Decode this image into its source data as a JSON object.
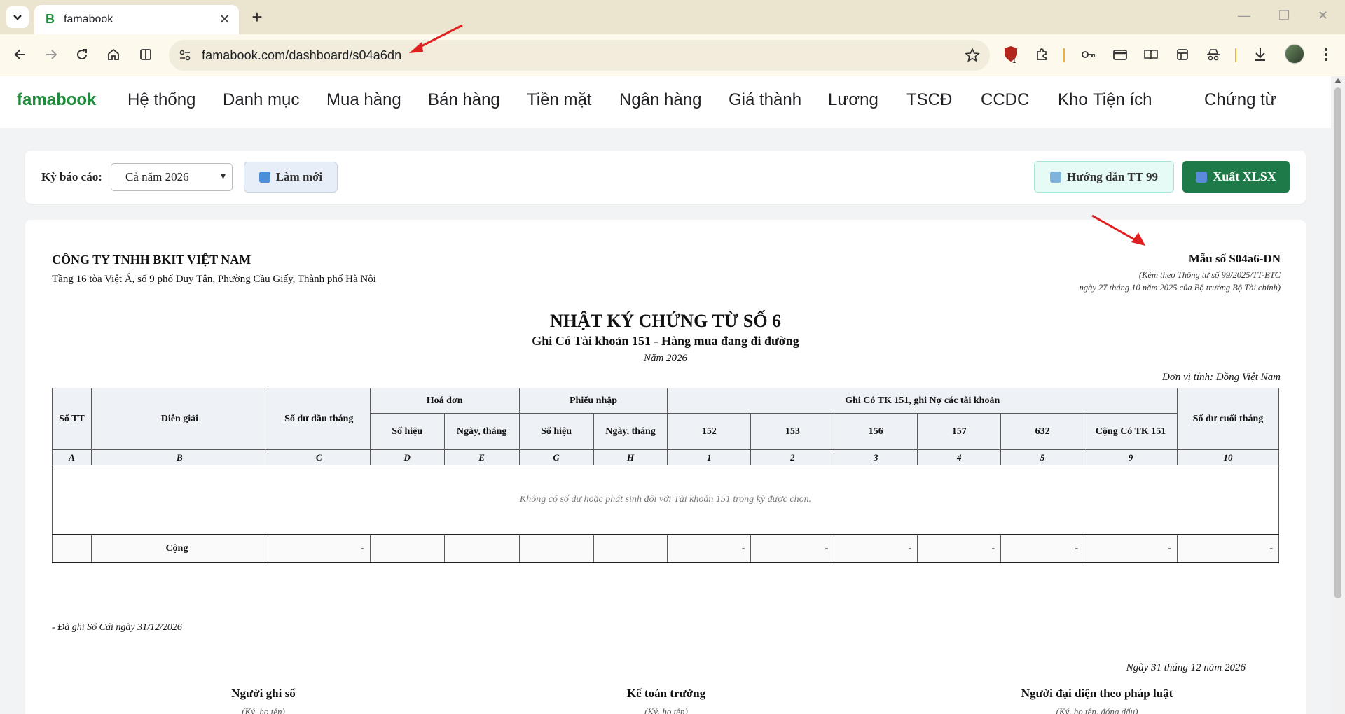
{
  "browser": {
    "tab_title": "famabook",
    "tab_favicon": "B",
    "url": "famabook.com/dashboard/s04a6dn",
    "extension_badge": "1",
    "icons": [
      "back-icon",
      "forward-icon",
      "reload-icon",
      "home-icon",
      "split-view-icon",
      "site-info-icon",
      "star-icon",
      "extension-icon",
      "puzzle-icon",
      "key-icon",
      "card-icon",
      "reading-list-icon",
      "tab-search-icon",
      "incognito-icon",
      "download-icon",
      "avatar"
    ]
  },
  "app": {
    "brand": "famabook",
    "nav": [
      "Hệ thống",
      "Danh mục",
      "Mua hàng",
      "Bán hàng",
      "Tiền mặt",
      "Ngân hàng",
      "Giá thành",
      "Lương",
      "TSCĐ",
      "CCDC",
      "Kho",
      "Tiện ích",
      "Chứng từ"
    ],
    "filter": {
      "label": "Kỳ báo cáo:",
      "period": "Cả năm 2026",
      "refresh": "Làm mới",
      "guide": "Hướng dẫn TT 99",
      "export": "Xuất XLSX"
    }
  },
  "report": {
    "company": "CÔNG TY TNHH BKIT VIỆT NAM",
    "address": "Tầng 16 tòa Việt Á, số 9 phố Duy Tân, Phường Cầu Giấy, Thành phố Hà Nội",
    "form_code": "Mẫu số S04a6-DN",
    "form_note1": "(Kèm theo Thông tư số 99/2025/TT-BTC",
    "form_note2": "ngày 27 tháng 10 năm 2025 của Bộ trưởng Bộ Tài chính)",
    "title": "NHẬT KÝ CHỨNG TỪ SỐ 6",
    "subtitle": "Ghi Có Tài khoản 151 - Hàng mua đang đi đường",
    "year": "Năm 2026",
    "unit": "Đơn vị tính: Đồng Việt Nam",
    "table": {
      "h_stt": "Số TT",
      "h_desc": "Diễn giải",
      "h_open": "Số dư đầu tháng",
      "h_invoice": "Hoá đơn",
      "h_receipt": "Phiếu nhập",
      "h_credit": "Ghi Có TK 151, ghi Nợ các tài khoản",
      "h_close": "Số dư cuối tháng",
      "h_so_hieu": "Số hiệu",
      "h_ngay": "Ngày, tháng",
      "accounts": [
        "152",
        "153",
        "156",
        "157",
        "632"
      ],
      "h_total_credit": "Cộng Có TK 151",
      "index_row": [
        "A",
        "B",
        "C",
        "D",
        "E",
        "G",
        "H",
        "1",
        "2",
        "3",
        "4",
        "5",
        "9",
        "10"
      ],
      "empty_msg": "Không có số dư hoặc phát sinh đối với Tài khoản 151 trong kỳ được chọn.",
      "total_label": "Cộng",
      "dash": "-"
    },
    "ledger_note": "- Đã ghi Sổ Cái ngày 31/12/2026",
    "sign_date": "Ngày 31 tháng 12 năm 2026",
    "signers": [
      {
        "title": "Người ghi sổ",
        "sub": "(Ký, họ tên)"
      },
      {
        "title": "Kế toán trưởng",
        "sub": "(Ký, họ tên)"
      },
      {
        "title": "Người đại diện theo pháp luật",
        "sub": "(Ký, họ tên, đóng dấu)"
      }
    ]
  },
  "colors": {
    "brand_green": "#1e8b3a",
    "export_green": "#1f7a4a",
    "annotation_arrow": "#e02020"
  }
}
